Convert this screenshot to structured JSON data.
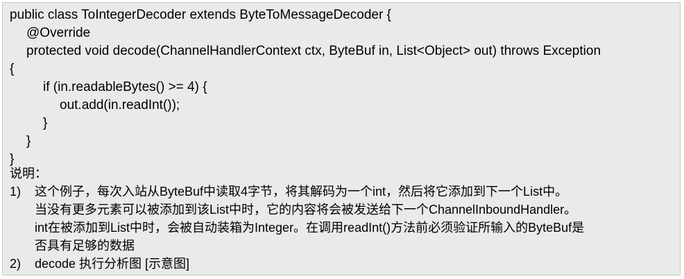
{
  "code": [
    "public class ToIntegerDecoder extends ByteToMessageDecoder {",
    "@Override",
    "protected void decode(ChannelHandlerContext  ctx, ByteBuf in, List<Object> out) throws Exception",
    "{",
    "if (in.readableBytes() >= 4) {",
    "out.add(in.readInt());",
    "}",
    "}",
    "}"
  ],
  "notes": {
    "heading": "说明：",
    "item1": {
      "number": "1)",
      "lines": [
        "这个例子，每次入站从ByteBuf中读取4字节，将其解码为一个int，然后将它添加到下一个List中。",
        "当没有更多元素可以被添加到该List中时，它的内容将会被发送给下一个ChannelInboundHandler。",
        "int在被添加到List中时，会被自动装箱为Integer。在调用readInt()方法前必须验证所输入的ByteBuf是",
        "否具有足够的数据"
      ]
    },
    "item2": {
      "number": "2)",
      "text": "decode 执行分析图 [示意图]"
    }
  }
}
